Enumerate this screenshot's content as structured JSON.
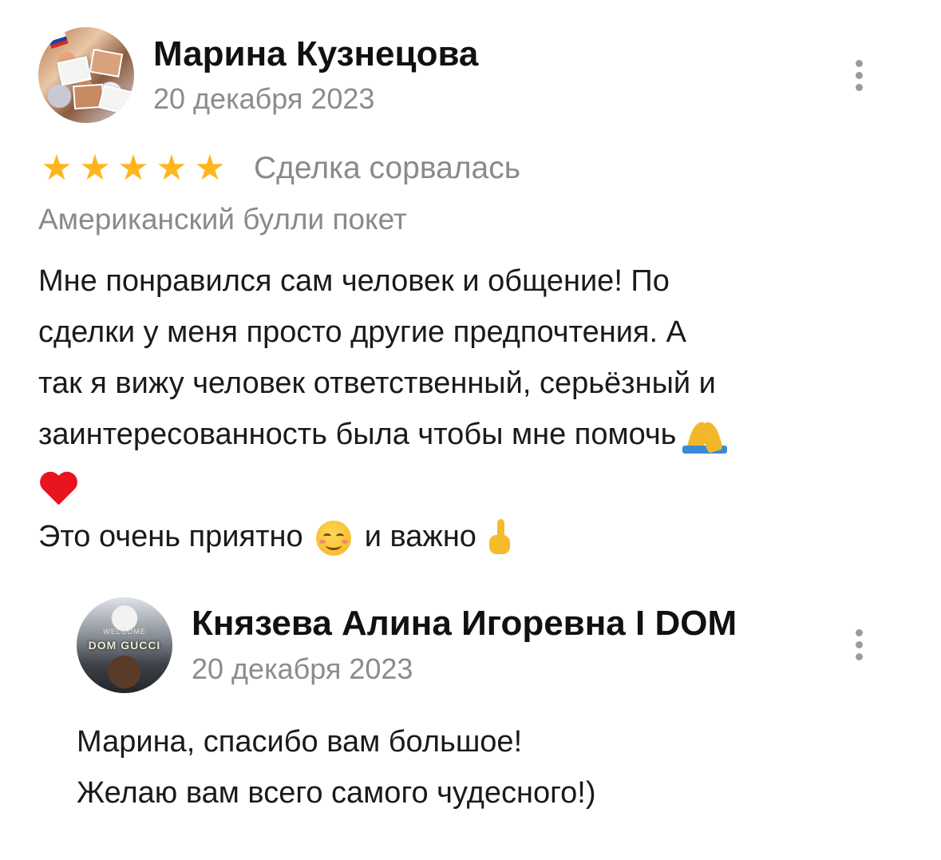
{
  "review": {
    "author": "Марина Кузнецова",
    "date": "20 декабря 2023",
    "rating": 5,
    "stars": [
      "★",
      "★",
      "★",
      "★",
      "★"
    ],
    "deal_status": "Сделка сорвалась",
    "listing_title": "Американский булли покет",
    "text_lines": [
      "Мне понравился сам человек и общение! По",
      "сделки у меня просто другие предпочтения. А",
      "так я вижу человек ответственный, серьёзный и",
      "заинтересованность была чтобы мне помочь"
    ],
    "line_last_a": "Это очень приятно",
    "line_last_b": "и важно",
    "emojis": [
      "pray-emoji",
      "heart-emoji",
      "smiling-face-emoji",
      "pointing-up-emoji"
    ]
  },
  "reply": {
    "author": "Князева Алина Игоревна I DOM",
    "date": "20 декабря 2023",
    "avatar_text_top": "WELCOME",
    "avatar_text_main": "DOM GUCCI",
    "text_lines": [
      "Марина, спасибо вам большое!",
      "Желаю вам всего самого чудесного!)"
    ]
  },
  "colors": {
    "star": "#ffb51c",
    "muted_text": "#8a8a8a",
    "body_text": "#1a1a1a",
    "menu_dots": "#9b9b9b"
  }
}
